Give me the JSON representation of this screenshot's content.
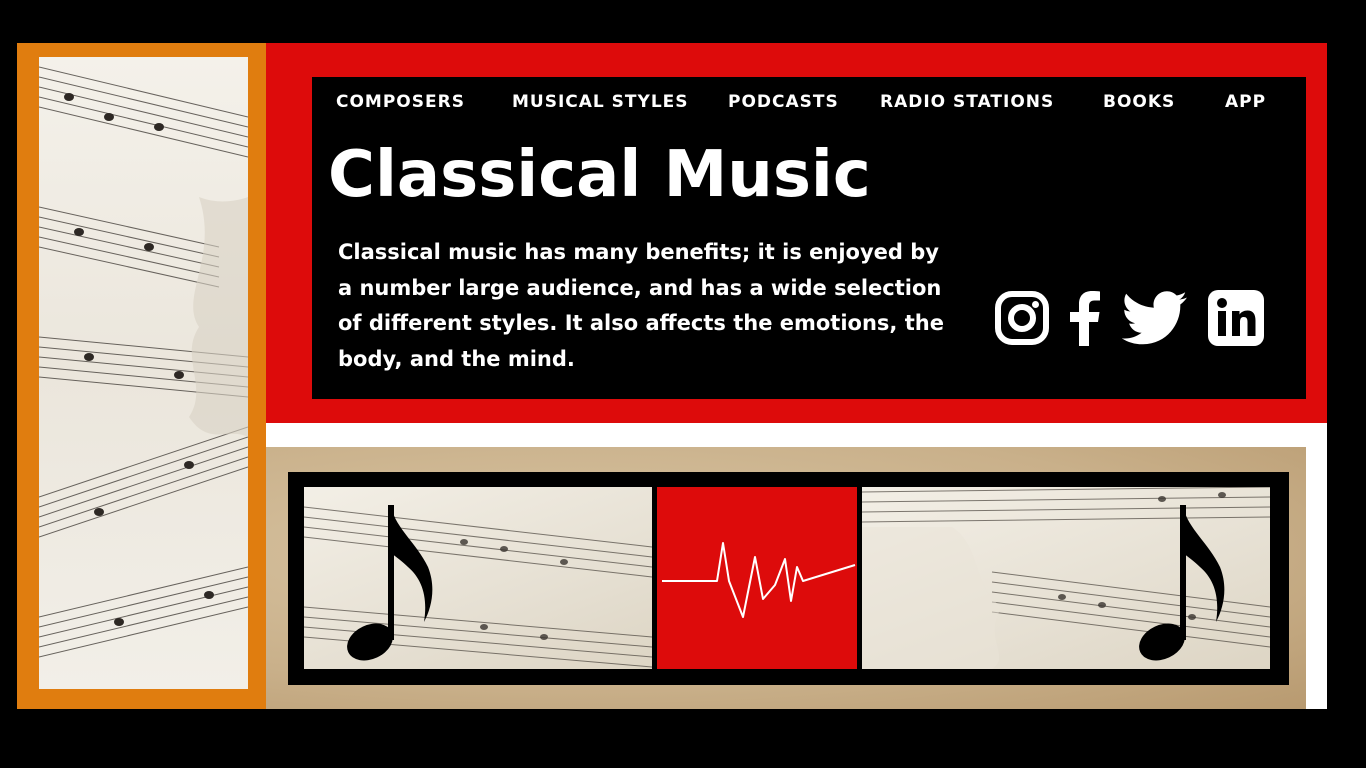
{
  "nav": {
    "items": [
      "COMPOSERS",
      "MUSICAL STYLES",
      "PODCASTS",
      "RADIO STATIONS",
      "BOOKS",
      "APP"
    ]
  },
  "hero": {
    "title": "Classical Music",
    "description": "Classical music has many benefits; it is enjoyed by a number large audience, and has a wide selection of different styles. It also affects the emotions, the body, and the mind."
  },
  "social": {
    "icons": [
      "instagram-icon",
      "facebook-icon",
      "twitter-icon",
      "linkedin-icon"
    ]
  },
  "colors": {
    "red": "#dd0b0b",
    "orange": "#e07d0f",
    "black": "#000000",
    "white": "#ffffff",
    "parchment": "#c9b08a"
  }
}
